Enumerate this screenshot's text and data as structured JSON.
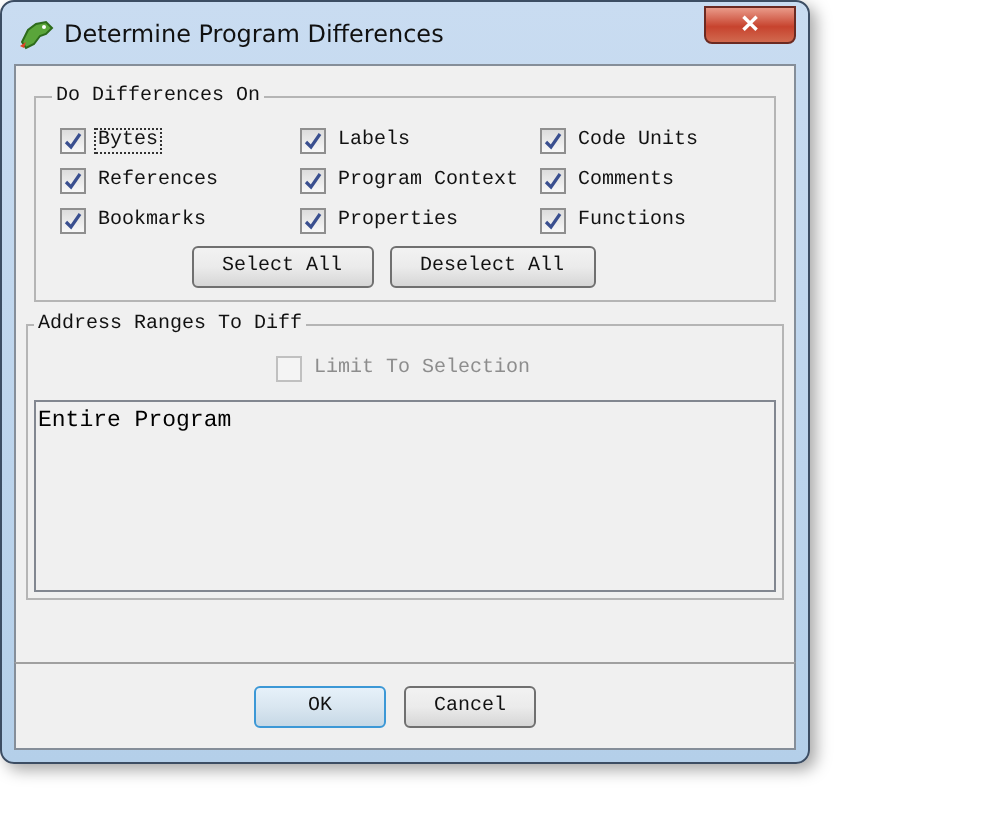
{
  "window": {
    "title": "Determine Program Differences",
    "close": "✕"
  },
  "differences": {
    "title": "Do Differences On",
    "options": [
      {
        "label": "Bytes",
        "checked": true,
        "focused": true
      },
      {
        "label": "Labels",
        "checked": true,
        "focused": false
      },
      {
        "label": "Code Units",
        "checked": true,
        "focused": false
      },
      {
        "label": "References",
        "checked": true,
        "focused": false
      },
      {
        "label": "Program Context",
        "checked": true,
        "focused": false
      },
      {
        "label": "Comments",
        "checked": true,
        "focused": false
      },
      {
        "label": "Bookmarks",
        "checked": true,
        "focused": false
      },
      {
        "label": "Properties",
        "checked": true,
        "focused": false
      },
      {
        "label": "Functions",
        "checked": true,
        "focused": false
      }
    ],
    "buttons": [
      "Select All",
      "Deselect All"
    ]
  },
  "address_ranges": {
    "title": "Address Ranges To Diff",
    "limit": {
      "label": "Limit To Selection",
      "checked": false,
      "disabled": true
    },
    "ranges": [
      "Entire Program"
    ]
  },
  "buttons": [
    {
      "label": "OK",
      "default": true
    },
    {
      "label": "Cancel",
      "default": false
    }
  ]
}
